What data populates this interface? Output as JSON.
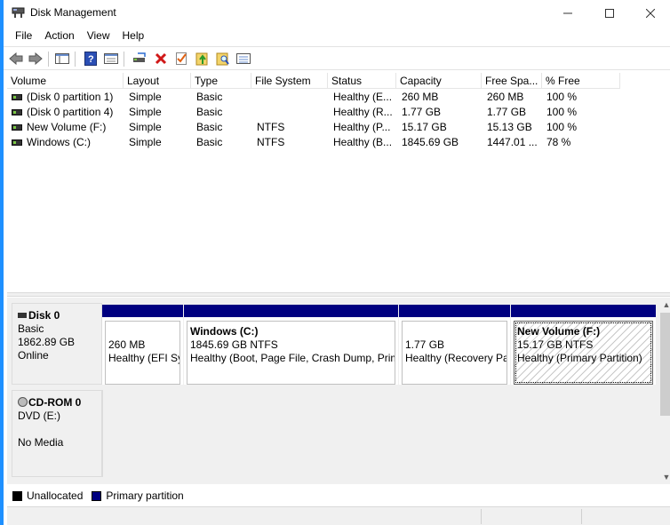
{
  "window": {
    "title": "Disk Management",
    "accent_color": "#1e90ff",
    "controls": [
      "minimize-icon",
      "maximize-icon",
      "close-icon"
    ]
  },
  "menu": [
    "File",
    "Action",
    "View",
    "Help"
  ],
  "toolbar": {
    "icons": [
      "back-arrow-icon",
      "forward-arrow-icon",
      "console-tree-icon",
      "help-icon",
      "properties-icon",
      "connect-drive-icon",
      "delete-icon",
      "checkmark-icon",
      "folder-up-icon",
      "search-folder-icon",
      "list-view-icon"
    ]
  },
  "volume_list": {
    "columns": [
      "Volume",
      "Layout",
      "Type",
      "File System",
      "Status",
      "Capacity",
      "Free Spa...",
      "% Free"
    ],
    "rows": [
      [
        "(Disk 0 partition 1)",
        "Simple",
        "Basic",
        "",
        "Healthy (E...",
        "260 MB",
        "260 MB",
        "100 %"
      ],
      [
        "(Disk 0 partition 4)",
        "Simple",
        "Basic",
        "",
        "Healthy (R...",
        "1.77 GB",
        "1.77 GB",
        "100 %"
      ],
      [
        "New Volume (F:)",
        "Simple",
        "Basic",
        "NTFS",
        "Healthy (P...",
        "15.17 GB",
        "15.13 GB",
        "100 %"
      ],
      [
        "Windows (C:)",
        "Simple",
        "Basic",
        "NTFS",
        "Healthy (B...",
        "1845.69 GB",
        "1447.01 ...",
        "78 %"
      ]
    ]
  },
  "disks": [
    {
      "name": "Disk 0",
      "lines": [
        "Basic",
        "1862.89 GB",
        "Online"
      ],
      "partitions": [
        {
          "title": "",
          "size": "260 MB",
          "status": "Healthy (EFI Sy"
        },
        {
          "title": "Windows  (C:)",
          "size": "1845.69 GB NTFS",
          "status": "Healthy (Boot, Page File, Crash Dump, Prim"
        },
        {
          "title": "",
          "size": "1.77 GB",
          "status": "Healthy (Recovery Pa"
        },
        {
          "title": "New Volume  (F:)",
          "size": "15.17 GB NTFS",
          "status": "Healthy (Primary Partition)"
        }
      ]
    },
    {
      "name": "CD-ROM 0",
      "lines": [
        "DVD (E:)",
        "",
        "No Media"
      ]
    }
  ],
  "legend": [
    {
      "label": "Unallocated",
      "color": "#000000"
    },
    {
      "label": "Primary partition",
      "color": "#000080"
    }
  ]
}
